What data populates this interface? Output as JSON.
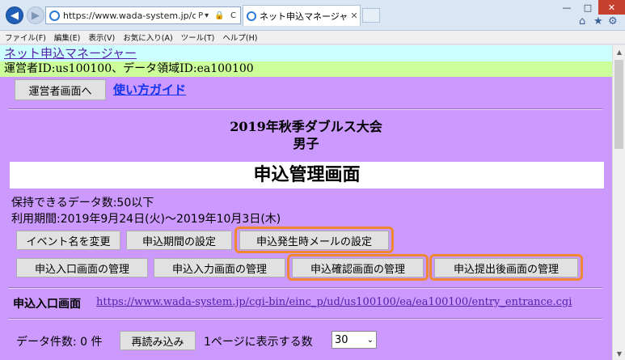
{
  "browser": {
    "url": "https://www.wada-system.jp/cgi-bin/einc_",
    "addr_tools": "P▾ 🔒 C",
    "tab_title": "ネット申込マネージャー 申込...",
    "menu": [
      "ファイル(F)",
      "編集(E)",
      "表示(V)",
      "お気に入り(A)",
      "ツール(T)",
      "ヘルプ(H)"
    ]
  },
  "page": {
    "site_link": "ネット申込マネージャー",
    "operator_line": "運営者ID:us100100、データ領域ID:ea100100",
    "operator_button": "運営者画面へ",
    "guide_link": "使い方ガイド",
    "title": "2019年秋季ダブルス大会",
    "subtitle": "男子",
    "heading": "申込管理画面",
    "capacity": "保持できるデータ数:50以下",
    "period": "利用期間:2019年9月24日(火)〜2019年10月3日(木)",
    "buttons_row1": [
      "イベント名を変更",
      "申込期間の設定",
      "申込発生時メールの設定"
    ],
    "buttons_row2": [
      "申込入口画面の管理",
      "申込入力画面の管理",
      "申込確認画面の管理",
      "申込提出後画面の管理"
    ],
    "entry_label": "申込入口画面",
    "entry_url": "https://www.wada-system.jp/cgi-bin/einc_p/ud/us100100/ea/ea100100/entry_entrance.cgi",
    "count_label": "データ件数: 0 件",
    "reload_button": "再読み込み",
    "perpage_label": "1ページに表示する数",
    "perpage_value": "30"
  },
  "colors": {
    "page_bg": "#cc99ff",
    "site_bar": "#ccffff",
    "operator_bar": "#ccff99",
    "highlight": "#ee8833"
  }
}
